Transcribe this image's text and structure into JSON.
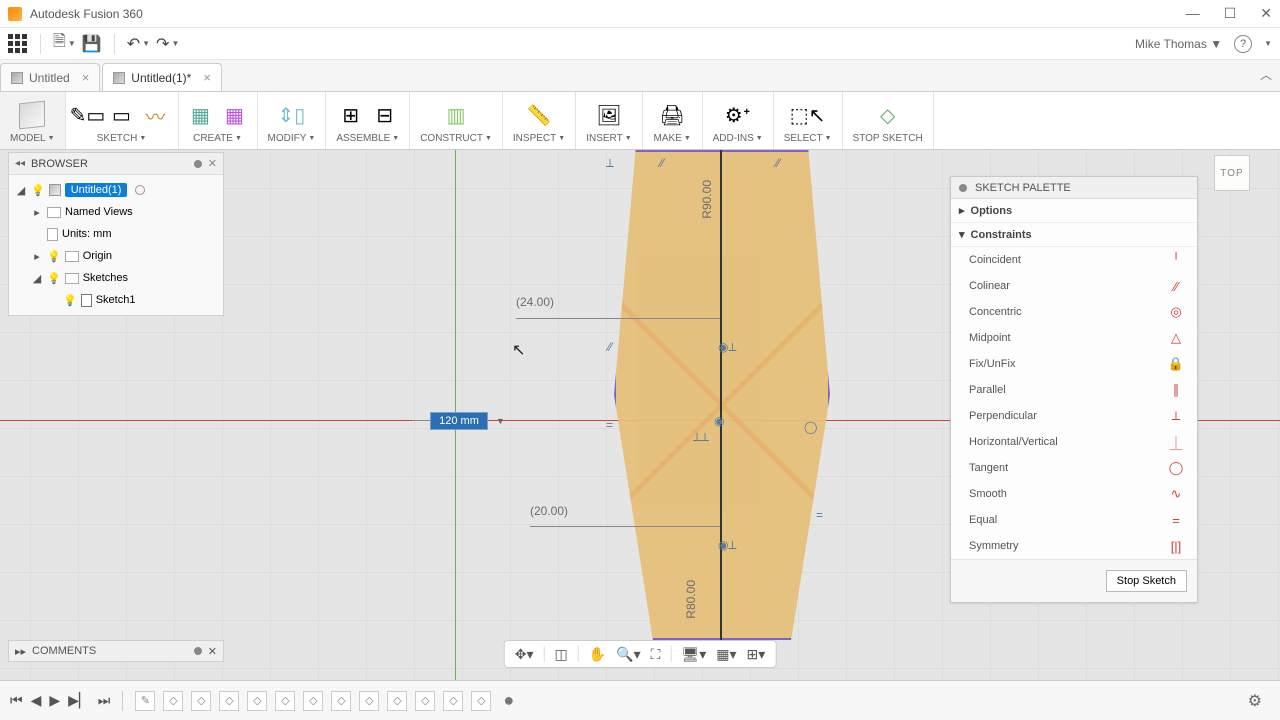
{
  "window": {
    "app_title": "Autodesk Fusion 360"
  },
  "quickbar": {
    "user_name": "Mike Thomas"
  },
  "tabs": [
    {
      "label": "Untitled",
      "active": false
    },
    {
      "label": "Untitled(1)*",
      "active": true
    }
  ],
  "ribbon": {
    "workspace": "MODEL",
    "groups": [
      {
        "label": "SKETCH"
      },
      {
        "label": "CREATE"
      },
      {
        "label": "MODIFY"
      },
      {
        "label": "ASSEMBLE"
      },
      {
        "label": "CONSTRUCT"
      },
      {
        "label": "INSPECT"
      },
      {
        "label": "INSERT"
      },
      {
        "label": "MAKE"
      },
      {
        "label": "ADD-INS"
      },
      {
        "label": "SELECT"
      },
      {
        "label": "STOP SKETCH"
      }
    ]
  },
  "browser": {
    "title": "BROWSER",
    "root": "Untitled(1)",
    "items": {
      "named_views": "Named Views",
      "units": "Units: mm",
      "origin": "Origin",
      "sketches": "Sketches",
      "sketch1": "Sketch1"
    }
  },
  "comments": {
    "title": "COMMENTS"
  },
  "viewcube": {
    "face": "TOP"
  },
  "canvas": {
    "input_value": "120 mm",
    "dims": {
      "d1": "(24.00)",
      "d2": "(20.00)",
      "r1": "R90.00",
      "r2": "R80.00"
    }
  },
  "palette": {
    "title": "SKETCH PALETTE",
    "sections": {
      "options": "Options",
      "constraints": "Constraints"
    },
    "constraints": [
      {
        "label": "Coincident",
        "glyph": "╵"
      },
      {
        "label": "Colinear",
        "glyph": "⁄⁄"
      },
      {
        "label": "Concentric",
        "glyph": "◎"
      },
      {
        "label": "Midpoint",
        "glyph": "△"
      },
      {
        "label": "Fix/UnFix",
        "glyph": "🔒"
      },
      {
        "label": "Parallel",
        "glyph": "∥"
      },
      {
        "label": "Perpendicular",
        "glyph": "⟂"
      },
      {
        "label": "Horizontal/Vertical",
        "glyph": "⏊"
      },
      {
        "label": "Tangent",
        "glyph": "◯"
      },
      {
        "label": "Smooth",
        "glyph": "∿"
      },
      {
        "label": "Equal",
        "glyph": "="
      },
      {
        "label": "Symmetry",
        "glyph": "[|]"
      }
    ],
    "stop_label": "Stop Sketch"
  }
}
